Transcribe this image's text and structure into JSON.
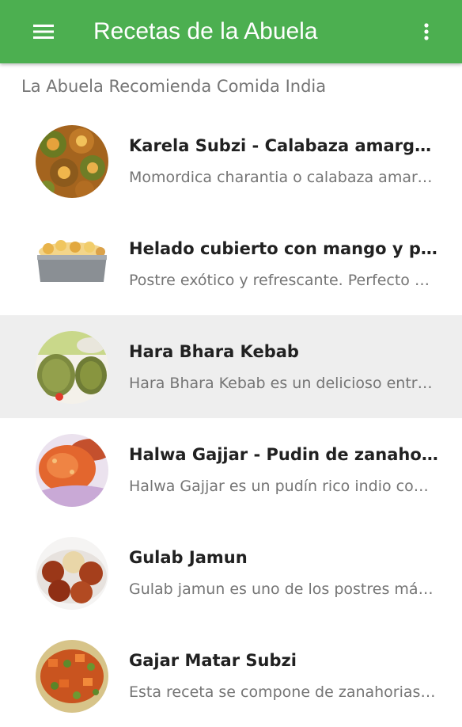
{
  "appbar": {
    "title": "Recetas de la Abuela",
    "color": "#4caf50",
    "menu_icon": "hamburger-menu-icon",
    "overflow_icon": "more-vertical-icon"
  },
  "section_header": "La Abuela Recomienda Comida India",
  "recipes": [
    {
      "title": "Karela Subzi - Calabaza amarga a la india",
      "subtitle": "Momordica charantia o calabaza amarga es una planta",
      "image": "karela-subzi-photo",
      "selected": false
    },
    {
      "title": "Helado cubierto con mango y pistachos",
      "subtitle": "Postre exótico y refrescante. Perfecto para el verano",
      "image": "mango-ice-cream-photo",
      "selected": false
    },
    {
      "title": "Hara Bhara Kebab",
      "subtitle": "Hara Bhara Kebab es un delicioso entrante vegetariano",
      "image": "hara-bhara-kebab-photo",
      "selected": true
    },
    {
      "title": "Halwa Gajjar - Pudin de zanahoria",
      "subtitle": "Halwa Gajjar es un pudín rico indio con zanahorias",
      "image": "halwa-gajjar-photo",
      "selected": false
    },
    {
      "title": "Gulab Jamun",
      "subtitle": "Gulab jamun es uno de los postres más populares",
      "image": "gulab-jamun-photo",
      "selected": false
    },
    {
      "title": "Gajar Matar Subzi",
      "subtitle": "Esta receta se compone de zanahorias y guisantes",
      "image": "gajar-matar-subzi-photo",
      "selected": false
    }
  ]
}
